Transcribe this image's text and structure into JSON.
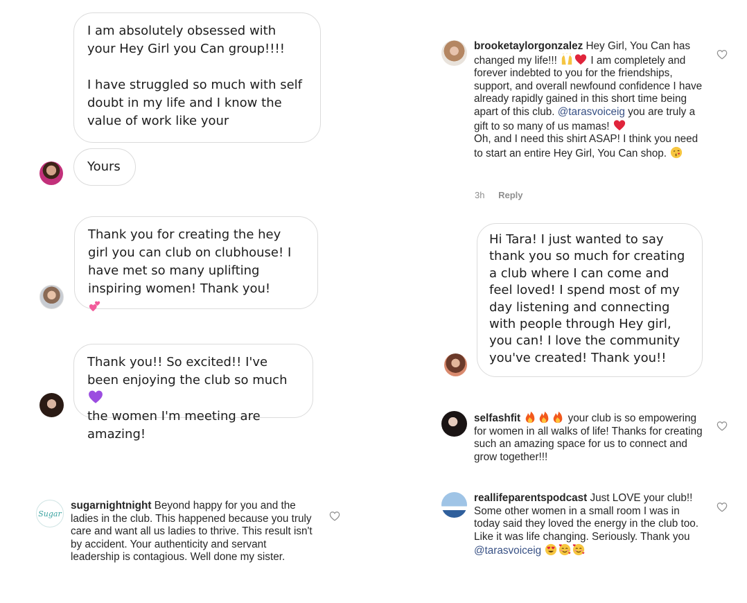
{
  "left": {
    "dm1": {
      "text": "I am absolutely obsessed with your Hey Girl you Can group!!!!\n\nI have struggled so much with self doubt in my life and I know the value of work like your",
      "follow_up": "Yours"
    },
    "dm2": {
      "text": "Thank you for creating the hey girl you can club on clubhouse! I have met so many uplifting inspiring women! Thank you!"
    },
    "dm3": {
      "text_before": "Thank you!! So excited!! I've been enjoying the club so much",
      "text_after": "the women I'm meeting are amazing!"
    },
    "comment1": {
      "username": "sugarnightnight",
      "text": "Beyond happy for you and the ladies in the club. This happened because you truly care and want all us ladies to thrive.  This result isn't by accident.  Your authenticity and servant leadership is contagious.  Well done my sister.",
      "avatar_text": "Sugar"
    }
  },
  "right": {
    "comment1": {
      "username": "brooketaylorgonzalez",
      "text_a": "Hey Girl, You Can has changed my life!!!",
      "text_b": "I am completely and forever indebted to you for the friendships, support, and overall newfound confidence I have already rapidly gained in this short time being apart of this club.",
      "mention": "@tarasvoiceig",
      "text_c": "you are truly a gift to so many of us mamas!",
      "text_d": "Oh, and I need this shirt ASAP! I think you need to start an entire Hey Girl, You Can shop.",
      "time": "3h",
      "reply": "Reply"
    },
    "dm1": {
      "text": "Hi Tara! I just wanted to say thank you so much for creating a club where I can come and feel loved! I spend most of my day listening and connecting with people through Hey girl, you can! I love the community you've created! Thank you!!"
    },
    "comment2": {
      "username": "selfashfit",
      "text": "your club is so empowering for women in all walks of life! Thanks for creating such an amazing space for us to connect and grow together!!!"
    },
    "comment3": {
      "username": "reallifeparentspodcast",
      "text": "Just LOVE your club!! Some other women in a small room I was in today said they loved the energy in the club too. Like it was life changing. Seriously. Thank you",
      "mention": "@tarasvoiceig"
    }
  },
  "icons": {
    "heart_outline": "heart-icon",
    "emojis": [
      "two-hearts",
      "purple-heart",
      "raising-hands",
      "red-heart",
      "kissing-face",
      "fire",
      "heart-eyes",
      "smiling-face-with-hearts"
    ]
  },
  "colors": {
    "bubble_border": "#dbdbdb",
    "mention": "#385185",
    "meta": "#8e8e8e"
  }
}
